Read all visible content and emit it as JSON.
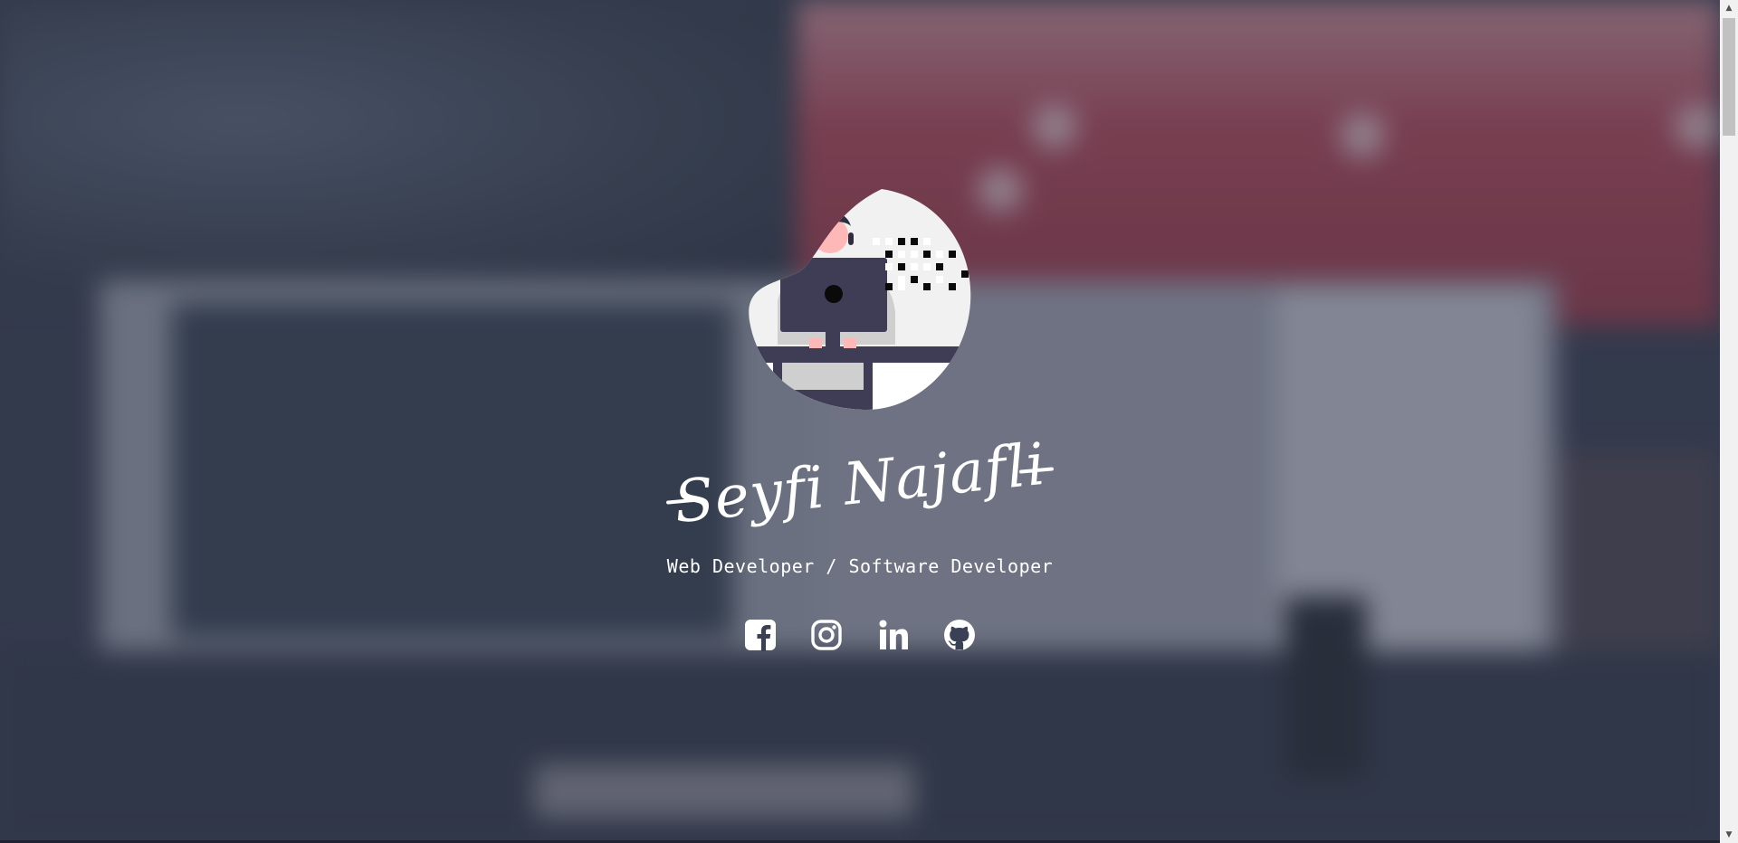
{
  "hero": {
    "name": "Seyfi Najafli",
    "subtitle": "Web Developer / Software Developer",
    "avatar_alt": "programmer-illustration"
  },
  "socials": [
    {
      "name": "facebook",
      "icon": "facebook-icon"
    },
    {
      "name": "instagram",
      "icon": "instagram-icon"
    },
    {
      "name": "linkedin",
      "icon": "linkedin-icon"
    },
    {
      "name": "github",
      "icon": "github-icon"
    }
  ],
  "colors": {
    "text": "#ffffff",
    "overlay": "#283042",
    "scrollbar_track": "#f1f1f1",
    "scrollbar_thumb": "#c1c1c1"
  }
}
